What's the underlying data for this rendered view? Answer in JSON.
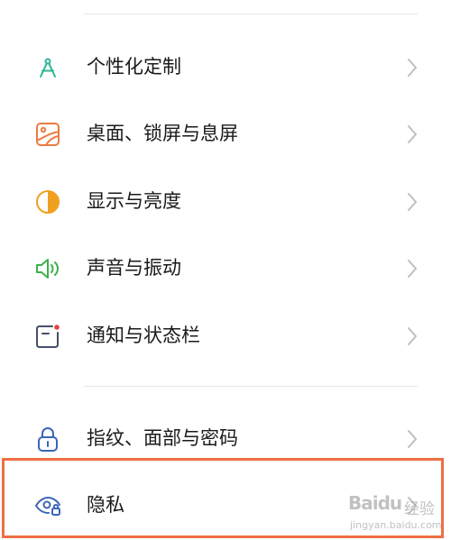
{
  "colors": {
    "personalize": "#2db69b",
    "desktop": "#ee7a40",
    "display": "#f0a020",
    "sound": "#3cb14b",
    "notification": "#45506a",
    "notification_dot": "#e9413f",
    "fingerprint": "#3a66b8",
    "privacy": "#3a66b8",
    "chevron": "#bfbfbf",
    "highlight_border": "#ee6f43",
    "divider": "#e6e6e6"
  },
  "settings": {
    "items": [
      {
        "label": "个性化定制",
        "icon": "compass-icon"
      },
      {
        "label": "桌面、锁屏与息屏",
        "icon": "wallpaper-icon"
      },
      {
        "label": "显示与亮度",
        "icon": "brightness-icon"
      },
      {
        "label": "声音与振动",
        "icon": "speaker-icon"
      },
      {
        "label": "通知与状态栏",
        "icon": "notification-icon"
      },
      {
        "label": "指纹、面部与密码",
        "icon": "lock-icon"
      },
      {
        "label": "隐私",
        "icon": "privacy-eye-icon"
      }
    ]
  },
  "watermark": {
    "brand": "Baidu",
    "suffix": "经验",
    "url": "jingyan.baidu.com"
  }
}
